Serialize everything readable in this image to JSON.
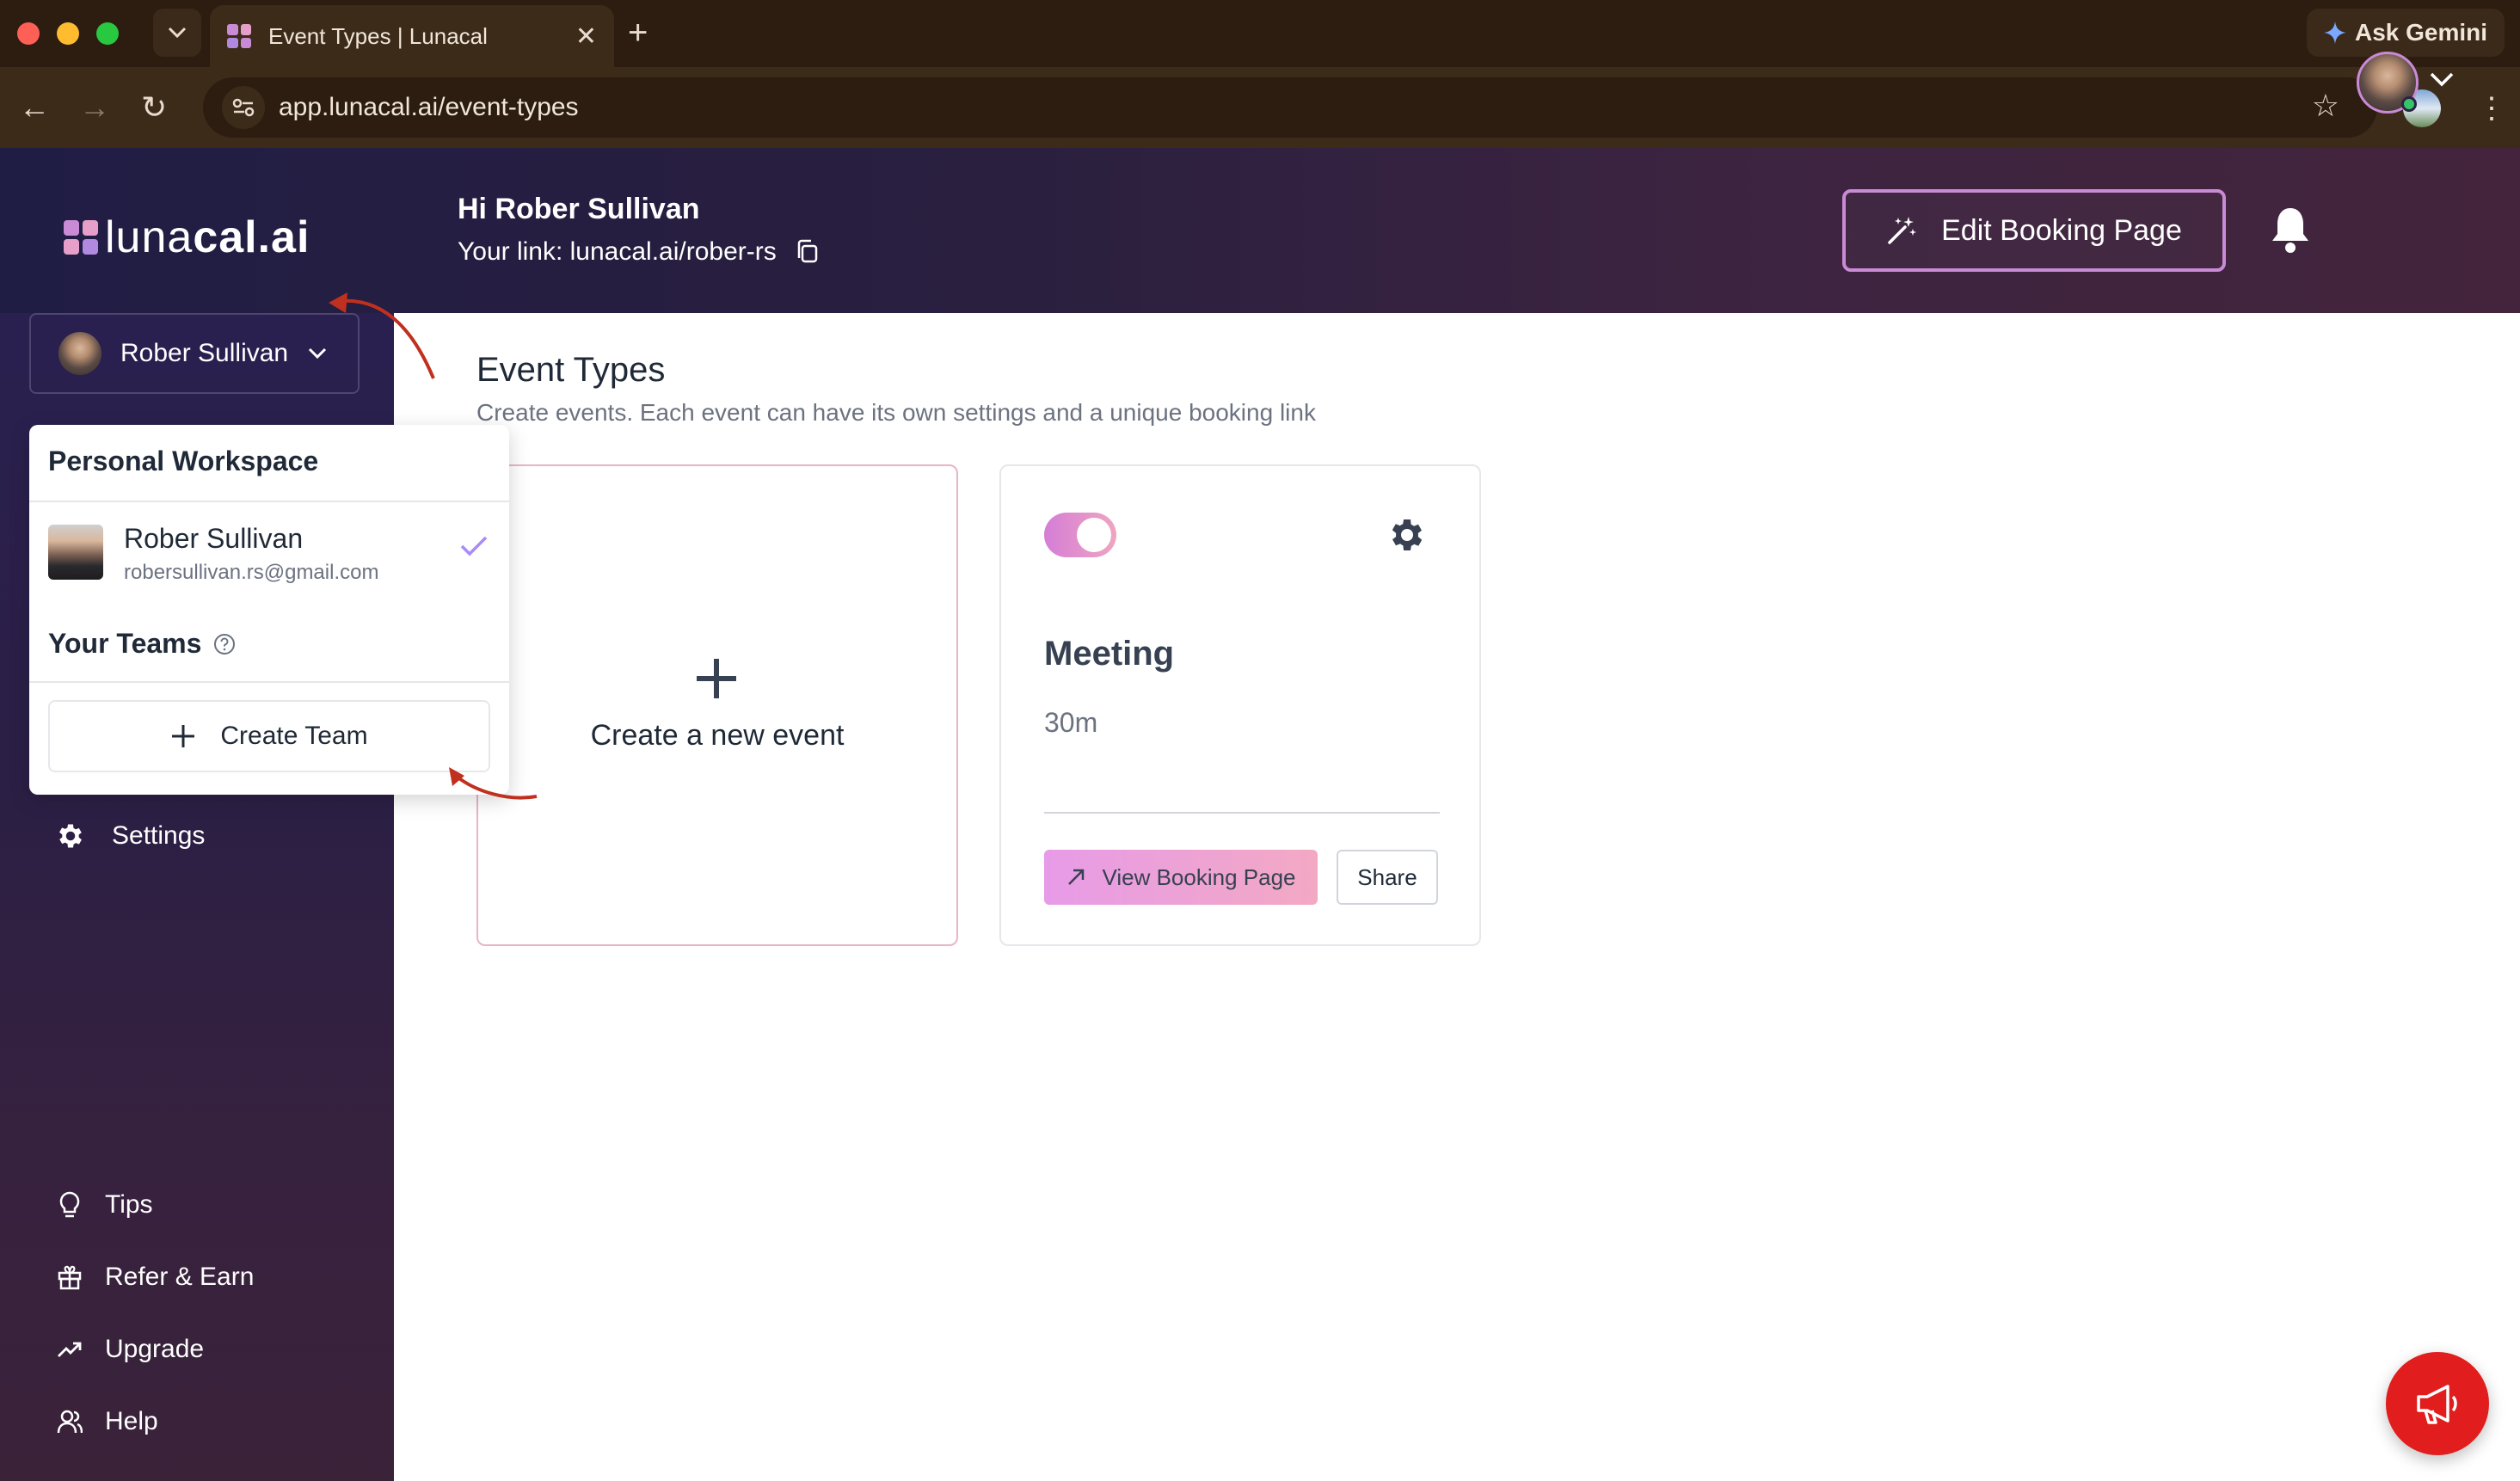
{
  "browser": {
    "tab_title": "Event Types | Lunacal",
    "url": "app.lunacal.ai/event-types",
    "gemini_label": "Ask Gemini"
  },
  "header": {
    "logo_light": "luna",
    "logo_bold": "cal",
    "logo_accent": ".ai",
    "greeting": "Hi Rober Sullivan",
    "your_link": "Your link: lunacal.ai/rober-rs",
    "edit_booking_label": "Edit Booking Page"
  },
  "sidebar": {
    "workspace_user": "Rober Sullivan",
    "items": [
      {
        "label": "Settings",
        "icon": "gear-icon"
      },
      {
        "label": "Tips",
        "icon": "lightbulb-icon"
      },
      {
        "label": "Refer & Earn",
        "icon": "gift-icon"
      },
      {
        "label": "Upgrade",
        "icon": "trending-up-icon"
      },
      {
        "label": "Help",
        "icon": "users-icon"
      }
    ]
  },
  "dropdown": {
    "title": "Personal Workspace",
    "user_name": "Rober Sullivan",
    "user_email": "robersullivan.rs@gmail.com",
    "teams_label": "Your Teams",
    "create_team_label": "Create Team"
  },
  "main": {
    "title": "Event Types",
    "subtitle": "Create events. Each event can have its own settings and a unique booking link",
    "new_event_label": "Create a new event",
    "event": {
      "title": "Meeting",
      "duration": "30m",
      "enabled": true,
      "view_label": "View Booking Page",
      "share_label": "Share"
    }
  },
  "colors": {
    "brand_pink": "#c98ad6",
    "fab_red": "#e11d1d",
    "annotation_red": "#c0301f"
  }
}
